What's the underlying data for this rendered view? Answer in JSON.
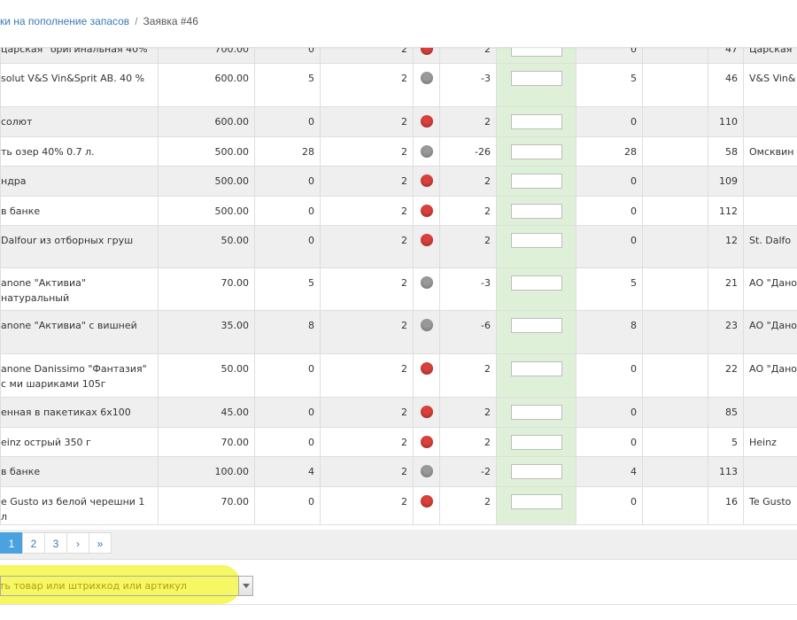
{
  "breadcrumb": {
    "parent": "ки на пополнение запасов",
    "separator": "/",
    "current": "Заявка #46"
  },
  "rows": [
    {
      "name": "царская\" оригинальная 40%",
      "price": "700.00",
      "c2": "0",
      "c3": "2",
      "status": "red",
      "c5": "2",
      "c7": "0",
      "c9": "47",
      "supplier": "Царская"
    },
    {
      "name": "solut V&S Vin&Sprit AB. 40 %",
      "price": "600.00",
      "c2": "5",
      "c3": "2",
      "status": "gray",
      "c5": "-3",
      "c7": "5",
      "c9": "46",
      "supplier": "V&S Vin&"
    },
    {
      "name": "солют",
      "price": "600.00",
      "c2": "0",
      "c3": "2",
      "status": "red",
      "c5": "2",
      "c7": "0",
      "c9": "110",
      "supplier": ""
    },
    {
      "name": "ть озер 40% 0.7 л.",
      "price": "500.00",
      "c2": "28",
      "c3": "2",
      "status": "gray",
      "c5": "-26",
      "c7": "28",
      "c9": "58",
      "supplier": "Омсквин"
    },
    {
      "name": "ндра",
      "price": "500.00",
      "c2": "0",
      "c3": "2",
      "status": "red",
      "c5": "2",
      "c7": "0",
      "c9": "109",
      "supplier": ""
    },
    {
      "name": "в банке",
      "price": "500.00",
      "c2": "0",
      "c3": "2",
      "status": "red",
      "c5": "2",
      "c7": "0",
      "c9": "112",
      "supplier": ""
    },
    {
      "name": "Dalfour из отборных груш",
      "price": "50.00",
      "c2": "0",
      "c3": "2",
      "status": "red",
      "c5": "2",
      "c7": "0",
      "c9": "12",
      "supplier": "St. Dalfo"
    },
    {
      "name": "anone \"Активиа\" натуральный",
      "price": "70.00",
      "c2": "5",
      "c3": "2",
      "status": "gray",
      "c5": "-3",
      "c7": "5",
      "c9": "21",
      "supplier": "АО \"Дано"
    },
    {
      "name": "anone \"Активиа\" с вишней",
      "price": "35.00",
      "c2": "8",
      "c3": "2",
      "status": "gray",
      "c5": "-6",
      "c7": "8",
      "c9": "23",
      "supplier": "АО \"Дано"
    },
    {
      "name": "anone Danissimo \"Фантазия\" с ми шариками 105г",
      "price": "50.00",
      "c2": "0",
      "c3": "2",
      "status": "red",
      "c5": "2",
      "c7": "0",
      "c9": "22",
      "supplier": "АО \"Дано"
    },
    {
      "name": "енная в пакетиках 6x100",
      "price": "45.00",
      "c2": "0",
      "c3": "2",
      "status": "red",
      "c5": "2",
      "c7": "0",
      "c9": "85",
      "supplier": ""
    },
    {
      "name": "einz острый 350 г",
      "price": "70.00",
      "c2": "0",
      "c3": "2",
      "status": "red",
      "c5": "2",
      "c7": "0",
      "c9": "5",
      "supplier": "Heinz"
    },
    {
      "name": "в банке",
      "price": "100.00",
      "c2": "4",
      "c3": "2",
      "status": "gray",
      "c5": "-2",
      "c7": "4",
      "c9": "113",
      "supplier": ""
    },
    {
      "name": "e Gusto из белой черешни 1 л",
      "price": "70.00",
      "c2": "0",
      "c3": "2",
      "status": "red",
      "c5": "2",
      "c7": "0",
      "c9": "16",
      "supplier": "Te Gusto"
    }
  ],
  "pagination": {
    "pages": [
      "1",
      "2",
      "3"
    ],
    "active": "1",
    "next": "›",
    "last": "»"
  },
  "search": {
    "placeholder": "ть товар или штрихкод или артикул"
  },
  "colors": {
    "link": "#3a7bb5",
    "active_page": "#4aa3df",
    "status_red": "#d9413b",
    "status_gray": "#999999",
    "input_column": "#dff0d8",
    "highlight": "#f4f85a"
  }
}
